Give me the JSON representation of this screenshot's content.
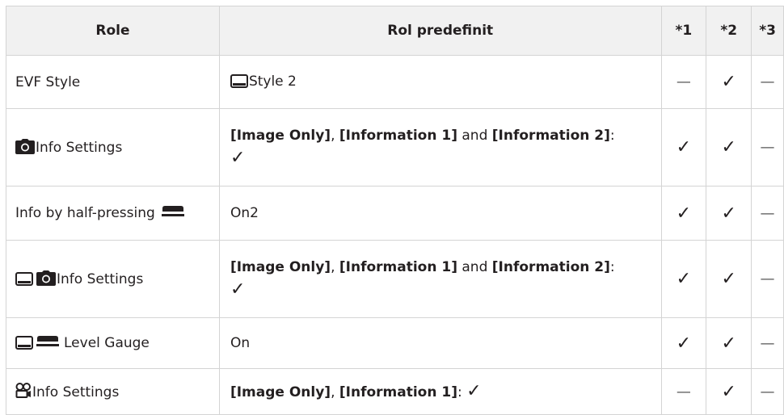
{
  "headers": {
    "role": "Role",
    "preset": "Rol predefinit",
    "c1": "*1",
    "c2": "*2",
    "c3": "*3"
  },
  "marks": {
    "check": "✓",
    "dash": "—"
  },
  "rows": [
    {
      "role": "EVF Style",
      "preset": "Style 2",
      "c1": "—",
      "c2": "✓",
      "c3": "—"
    },
    {
      "role": "Info Settings",
      "preset": {
        "p1": "[Image Only]",
        "s1": ", ",
        "p2": "[Information 1]",
        "s2": " and ",
        "p3": "[Information 2]",
        "s3": ":",
        "check": "✓"
      },
      "c1": "✓",
      "c2": "✓",
      "c3": "—"
    },
    {
      "role": "Info by half-pressing",
      "preset": "On2",
      "c1": "✓",
      "c2": "✓",
      "c3": "—"
    },
    {
      "role": "Info Settings",
      "preset": {
        "p1": "[Image Only]",
        "s1": ", ",
        "p2": "[Information 1]",
        "s2": " and ",
        "p3": "[Information 2]",
        "s3": ":",
        "check": "✓"
      },
      "c1": "✓",
      "c2": "✓",
      "c3": "—"
    },
    {
      "role": "Level Gauge",
      "preset": "On",
      "c1": "✓",
      "c2": "✓",
      "c3": "—"
    },
    {
      "role": "Info Settings",
      "preset": {
        "p1": "[Image Only]",
        "s1": ", ",
        "p2": "[Information 1]",
        "s2": ": ",
        "check": "✓"
      },
      "c1": "—",
      "c2": "✓",
      "c3": "—"
    }
  ]
}
